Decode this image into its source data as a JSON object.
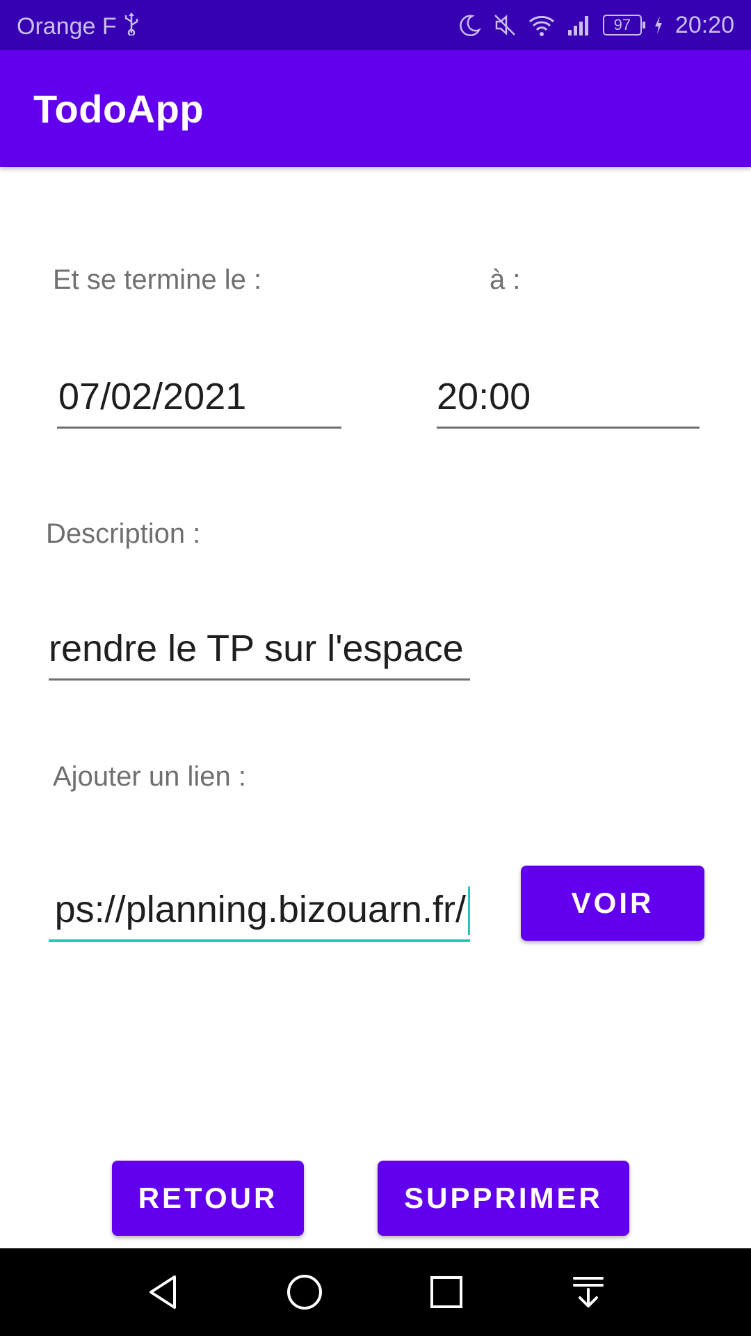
{
  "status_bar": {
    "carrier": "Orange F",
    "battery": "97",
    "time": "20:20"
  },
  "app": {
    "title": "TodoApp"
  },
  "form": {
    "end_date_label": "Et se termine le :",
    "end_time_label": "à :",
    "end_date_value": "07/02/2021",
    "end_time_value": "20:00",
    "description_label": "Description :",
    "description_value": "rendre le TP sur l'espace r",
    "link_label": "Ajouter un lien :",
    "link_value": "ps://planning.bizouarn.fr/",
    "view_button": "VOIR"
  },
  "actions": {
    "back_button": "RETOUR",
    "delete_button": "SUPPRIMER"
  },
  "colors": {
    "status_bar": "#3700b3",
    "primary": "#6200ee",
    "accent": "#1ec8bd"
  }
}
